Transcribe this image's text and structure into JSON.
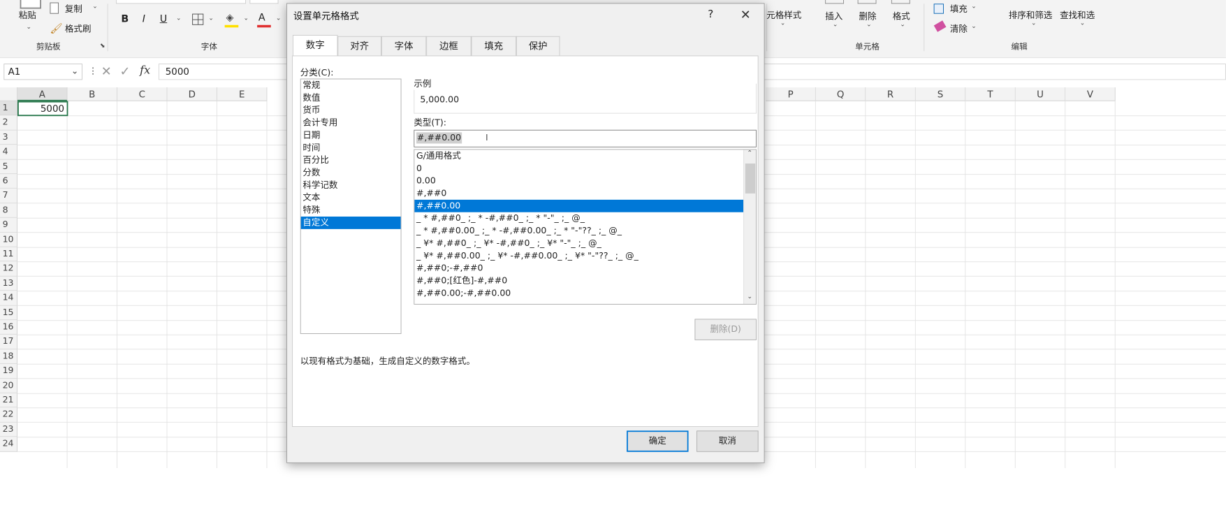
{
  "ribbon": {
    "paste": "粘贴",
    "copy": "复制",
    "format_painter": "格式刷",
    "clipboard": "剪贴板",
    "bold": "B",
    "italic": "I",
    "underline": "U",
    "font": "字体",
    "cell_styles": "元格样式",
    "insert": "插入",
    "delete": "删除",
    "format": "格式",
    "cells": "单元格",
    "fill": "填充",
    "clear": "清除",
    "sort_filter": "排序和筛选",
    "find_select": "查找和选",
    "editing": "编辑",
    "font_color": "#e03030",
    "highlight_color": "#ffe000"
  },
  "formula_bar": {
    "name_box": "A1",
    "fx": "fx",
    "value": "5000"
  },
  "sheet": {
    "columns": [
      "A",
      "B",
      "C",
      "D",
      "E",
      "P",
      "Q",
      "R",
      "S",
      "T",
      "U",
      "V"
    ],
    "rows": [
      "1",
      "2",
      "3",
      "4",
      "5",
      "6",
      "7",
      "8",
      "9",
      "10",
      "11",
      "12",
      "13",
      "14",
      "15",
      "16",
      "17",
      "18",
      "19",
      "20",
      "21",
      "22",
      "23",
      "24"
    ],
    "a1": "5000"
  },
  "dialog": {
    "title": "设置单元格格式",
    "help": "?",
    "close": "✕",
    "tabs": [
      "数字",
      "对齐",
      "字体",
      "边框",
      "填充",
      "保护"
    ],
    "category_label": "分类(C):",
    "categories": [
      "常规",
      "数值",
      "货币",
      "会计专用",
      "日期",
      "时间",
      "百分比",
      "分数",
      "科学记数",
      "文本",
      "特殊",
      "自定义"
    ],
    "selected_category": "自定义",
    "sample_label": "示例",
    "sample_value": "5,000.00",
    "type_label": "类型(T):",
    "type_value": "#,##0.00",
    "types": [
      "G/通用格式",
      "0",
      "0.00",
      "#,##0",
      "#,##0.00",
      "_ * #,##0_ ;_ * -#,##0_ ;_ * \"-\"_ ;_ @_ ",
      "_ * #,##0.00_ ;_ * -#,##0.00_ ;_ * \"-\"??_ ;_ @_ ",
      "_ ¥* #,##0_ ;_ ¥* -#,##0_ ;_ ¥* \"-\"_ ;_ @_ ",
      "_ ¥* #,##0.00_ ;_ ¥* -#,##0.00_ ;_ ¥* \"-\"??_ ;_ @_ ",
      "#,##0;-#,##0",
      "#,##0;[红色]-#,##0",
      "#,##0.00;-#,##0.00"
    ],
    "selected_type": "#,##0.00",
    "delete_button": "删除(D)",
    "description": "以现有格式为基础，生成自定义的数字格式。",
    "ok": "确定",
    "cancel": "取消"
  }
}
